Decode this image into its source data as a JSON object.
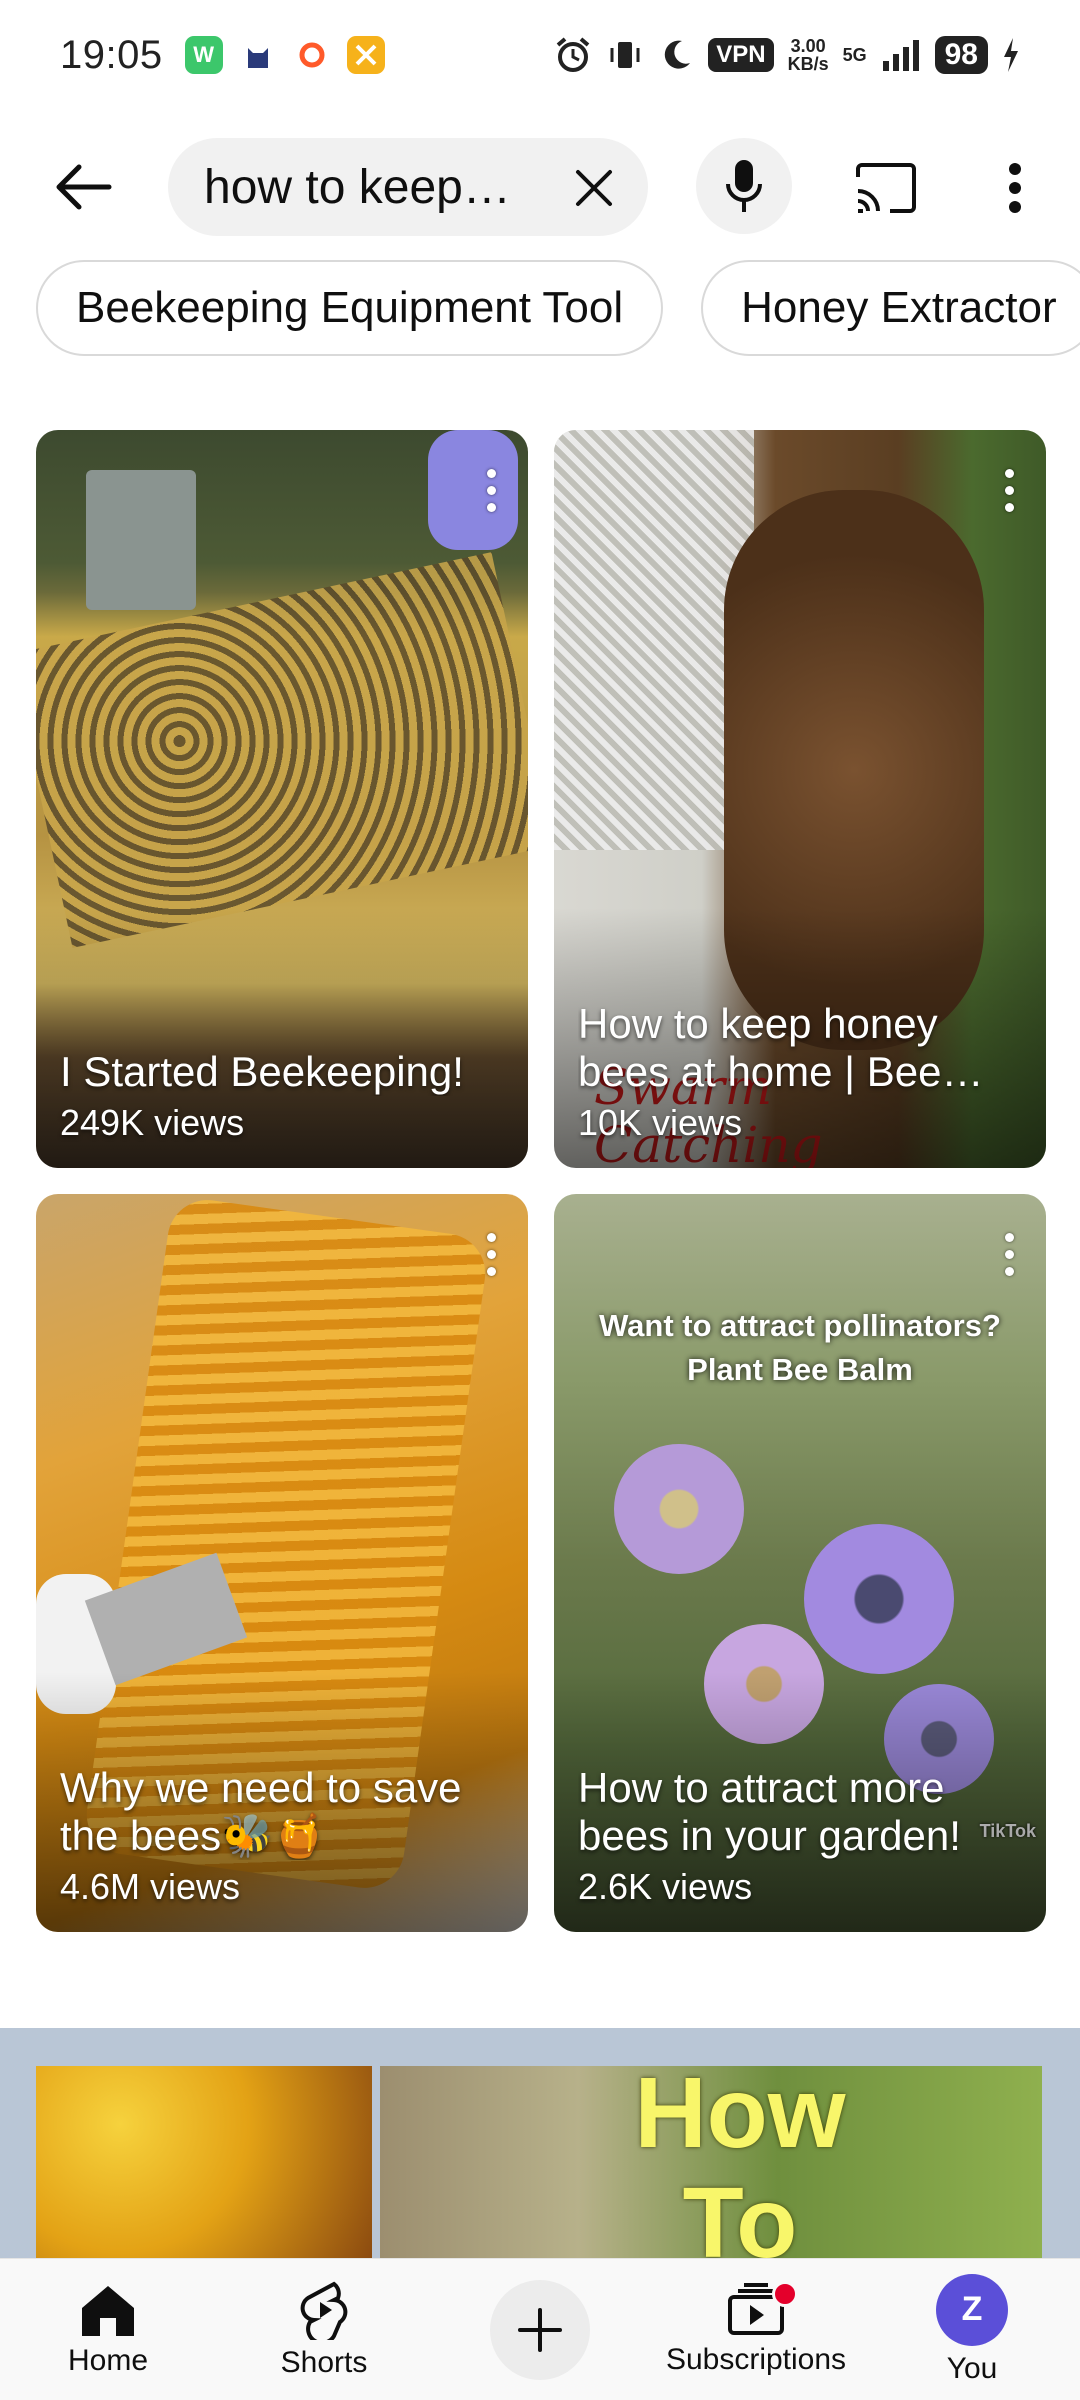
{
  "status_bar": {
    "time": "19:05",
    "vpn": "VPN",
    "speed_value": "3.00",
    "speed_unit": "KB/s",
    "network": "5G",
    "battery": "98",
    "apps": [
      {
        "name": "wechat-app-icon",
        "color": "#3cc76b"
      },
      {
        "name": "cat-app-icon",
        "color": "#ffffff"
      },
      {
        "name": "circle-app-icon",
        "color": "#ffffff"
      },
      {
        "name": "tools-app-icon",
        "color": "#f6b21b"
      }
    ]
  },
  "search": {
    "query": "how to keep…"
  },
  "chips": [
    {
      "label": "Beekeeping Equipment Tool"
    },
    {
      "label": "Honey Extractor"
    }
  ],
  "videos": [
    {
      "title": "I Started Beekeeping!",
      "views": "249K views"
    },
    {
      "title": "How to keep honey bees at home | Bee…",
      "views": "10K views"
    },
    {
      "title": "Why we need to save the bees🐝🍯",
      "views": "4.6M views"
    },
    {
      "title": "How to attract more bees in your garden!",
      "views": "2.6K views",
      "overlay": "Want to attract pollinators?\nPlant Bee Balm"
    }
  ],
  "banner": {
    "headline": "How To"
  },
  "bottom_nav": {
    "items": [
      {
        "label": "Home"
      },
      {
        "label": "Shorts"
      },
      {
        "label": ""
      },
      {
        "label": "Subscriptions"
      },
      {
        "label": "You"
      }
    ],
    "avatar_letter": "Z"
  },
  "colors": {
    "avatar": "#5b4fd8",
    "notification": "#e4002b"
  }
}
